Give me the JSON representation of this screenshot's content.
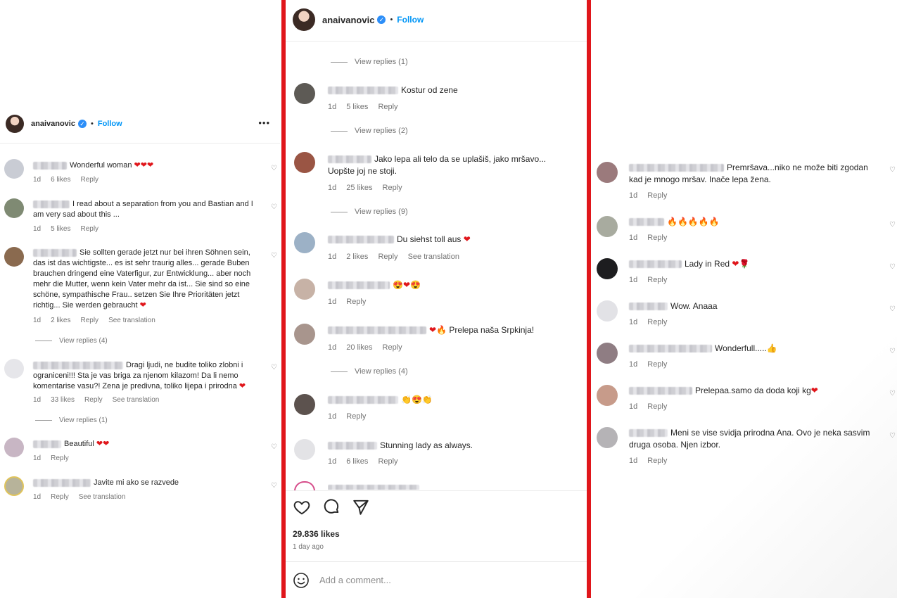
{
  "header": {
    "username": "anaivanovic",
    "follow": "Follow",
    "dot": "•",
    "verified": "✓",
    "more": "•••"
  },
  "left": {
    "comments": [
      {
        "text": "Wonderful woman",
        "emoji": "❤❤❤",
        "time": "1d",
        "likes": "6 likes",
        "reply": "Reply"
      },
      {
        "text": "I read about a separation from you and Bastian and I am very sad about this ...",
        "time": "1d",
        "likes": "5 likes",
        "reply": "Reply"
      },
      {
        "text": "Sie sollten gerade jetzt nur bei ihren Söhnen sein, das ist das wichtigste... es ist sehr traurig alles... gerade Buben brauchen dringend eine Vaterfigur, zur Entwicklung... aber noch mehr die Mutter, wenn kein Vater mehr da ist... Sie sind so eine schöne, sympathische Frau.. setzen Sie Ihre Prioritäten jetzt richtig... Sie werden gebraucht",
        "emoji": "❤",
        "time": "1d",
        "likes": "2 likes",
        "reply": "Reply",
        "translation": "See translation",
        "view_replies": "View replies (4)"
      },
      {
        "text": "Dragi ljudi, ne budite toliko zlobni i ograniceni!!! Sta je vas briga za njenom kilazom! Da li nemo komentarise vasu?! Zena je predivna, toliko lijepa i prirodna",
        "emoji": "❤",
        "time": "1d",
        "likes": "33 likes",
        "reply": "Reply",
        "translation": "See translation",
        "view_replies": "View replies (1)"
      },
      {
        "text": "Beautiful",
        "emoji": "❤❤",
        "time": "1d",
        "reply": "Reply"
      },
      {
        "text": "Javite mi ako se razvede",
        "time": "1d",
        "reply": "Reply",
        "translation": "See translation"
      }
    ]
  },
  "mid": {
    "top_view_replies": "View replies (1)",
    "comments": [
      {
        "text": "Kostur od zene",
        "time": "1d",
        "likes": "5 likes",
        "reply": "Reply",
        "view_replies": "View replies (2)"
      },
      {
        "text": "Jako lepa ali telo da se uplašiš, jako mršavo... Uopšte joj ne stoji.",
        "time": "1d",
        "likes": "25 likes",
        "reply": "Reply",
        "view_replies": "View replies (9)"
      },
      {
        "text": "Du siehst toll aus",
        "emoji": "❤",
        "time": "1d",
        "likes": "2 likes",
        "reply": "Reply",
        "translation": "See translation"
      },
      {
        "text": "",
        "emoji": "😍❤😍",
        "time": "1d",
        "reply": "Reply"
      },
      {
        "text": "Prelepa naša Srpkinja!",
        "emoji": "❤🔥",
        "time": "1d",
        "likes": "20 likes",
        "reply": "Reply",
        "view_replies": "View replies (4)"
      },
      {
        "text": "",
        "emoji": "👏😍👏",
        "time": "1d",
        "reply": "Reply"
      },
      {
        "text": "Stunning lady as always.",
        "time": "1d",
        "likes": "6 likes",
        "reply": "Reply"
      }
    ],
    "likes_total": "29.836 likes",
    "posted": "1 day ago",
    "add_comment": "Add a comment..."
  },
  "right": {
    "comments": [
      {
        "text": "Premršava...niko ne može biti zgodan kad je mnogo mršav. Inače lepa žena.",
        "time": "1d",
        "reply": "Reply"
      },
      {
        "text": "",
        "emoji": "🔥🔥🔥🔥🔥",
        "time": "1d",
        "reply": "Reply"
      },
      {
        "text": "Lady in Red",
        "emoji": "❤🌹",
        "time": "1d",
        "reply": "Reply"
      },
      {
        "text": "Wow. Anaaa",
        "time": "1d",
        "reply": "Reply"
      },
      {
        "text": "Wonderfull.....",
        "emoji": "👍",
        "time": "1d",
        "reply": "Reply"
      },
      {
        "text": "Prelepaa.samo da doda koji kg",
        "emoji": "❤",
        "time": "1d",
        "reply": "Reply"
      },
      {
        "text": "Meni se vise svidja prirodna Ana. Ovo je neka sasvim druga osoba. Njen izbor.",
        "time": "1d",
        "reply": "Reply"
      }
    ]
  },
  "colors": {
    "accent": "#0095f6",
    "frame": "#e0161b",
    "heart": "#e0161b"
  }
}
